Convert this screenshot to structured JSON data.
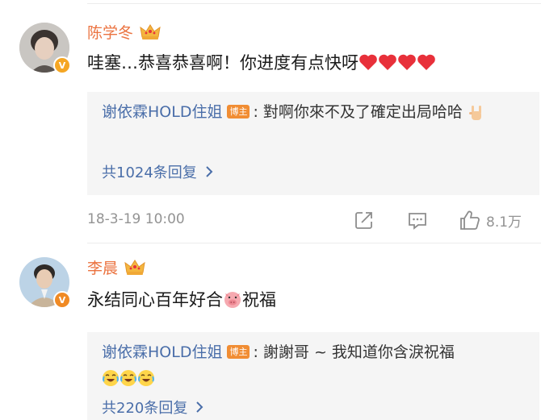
{
  "comments": [
    {
      "username": "陈学冬",
      "text": "哇塞…恭喜恭喜啊！你进度有点快呀",
      "reply": {
        "author": "谢依霖HOLD住姐",
        "tag": "博主",
        "text": ": 對啊你來不及了確定出局哈哈",
        "count_label": "共1024条回复"
      },
      "timestamp": "18-3-19 10:00",
      "like_count": "8.1万"
    },
    {
      "username": "李晨",
      "text_before": "永结同心百年好合",
      "text_after": "祝福",
      "reply": {
        "author": "谢依霖HOLD住姐",
        "tag": "博主",
        "text": ": 謝謝哥 ~ 我知道你含淚祝福",
        "count_label": "共220条回复"
      }
    }
  ],
  "colors": {
    "username": "#eb7340",
    "reply_author": "#4a6ea9",
    "blogger_tag": "#f18d33",
    "verified_badge": "#f5a623",
    "heart": "#e8303a"
  },
  "icons": [
    "crown-icon",
    "verified-badge-icon",
    "heart-emoji",
    "rock-hand-emoji",
    "chevron-right-icon",
    "share-icon",
    "comment-icon",
    "like-icon",
    "laughing-crying-emoji",
    "pig-emoji"
  ]
}
